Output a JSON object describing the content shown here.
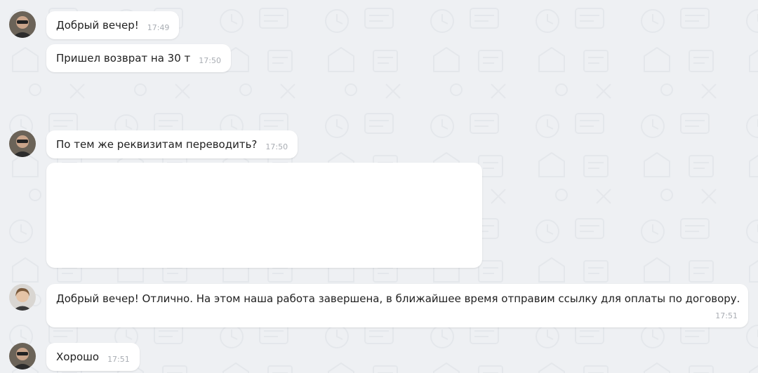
{
  "colors": {
    "chat_background": "#eef0f3",
    "bubble": "#ffffff",
    "text": "#1f1f1f",
    "timestamp": "#a9adb3"
  },
  "messages": [
    {
      "text": "Добрый вечер!",
      "time": "17:49"
    },
    {
      "text": "Пришел возврат на 30 т",
      "time": "17:50"
    },
    {
      "text": "По тем же реквизитам переводить?",
      "time": "17:50"
    },
    {
      "text": "Добрый вечер! Отлично. На этом наша работа завершена, в ближайшее время отправим ссылку для оплаты по договору.",
      "time": "17:51"
    },
    {
      "text": "Хорошо",
      "time": "17:51"
    }
  ],
  "icons": {
    "wallpaper": "doodle-pattern-icon",
    "avatar_client": "user-avatar-icon",
    "avatar_manager": "manager-avatar-icon"
  }
}
